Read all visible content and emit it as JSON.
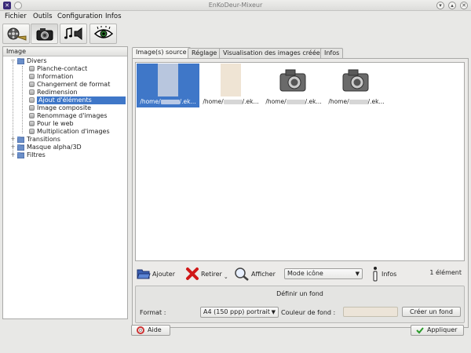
{
  "window": {
    "title": "EnKoDeur-Mixeur"
  },
  "menu": [
    {
      "label": "Fichier"
    },
    {
      "label": "Outils"
    },
    {
      "label": "Configuration"
    },
    {
      "label": "Infos"
    }
  ],
  "left_panel": {
    "header": "Image",
    "tree": {
      "divers": "Divers",
      "items": [
        "Planche-contact",
        "Information",
        "Changement de format",
        "Redimension",
        "Ajout d'éléments",
        "Image composite",
        "Renommage d'images",
        "Pour le web",
        "Multiplication d'images"
      ],
      "selected_index": 4,
      "transitions": "Transitions",
      "masque": "Masque alpha/3D",
      "filtres": "Filtres"
    }
  },
  "tabs": [
    {
      "label": "Image(s) source"
    },
    {
      "label": "Réglage"
    },
    {
      "label": "Visualisation des images créées"
    },
    {
      "label": "Infos"
    }
  ],
  "thumbnails": [
    {
      "prefix": "/home/",
      "suffix": "/.ek..."
    },
    {
      "prefix": "/home/",
      "suffix": "/.ek..."
    },
    {
      "prefix": "/home/",
      "suffix": "/.ek..."
    },
    {
      "prefix": "/home/",
      "suffix": "/.ek..."
    }
  ],
  "actions": {
    "ajouter": "Ajouter",
    "retirer": "Retirer",
    "afficher": "Afficher",
    "mode": "Mode icône",
    "infos": "Infos",
    "count": "1 élément"
  },
  "fond": {
    "title": "Définir un fond",
    "format_label": "Format :",
    "format_value": "A4 (150 ppp) portrait",
    "couleur_label": "Couleur de fond :",
    "couleur_value": "#ece4d8",
    "create": "Créer un fond"
  },
  "footer": {
    "aide": "Aide",
    "appliquer": "Appliquer"
  }
}
